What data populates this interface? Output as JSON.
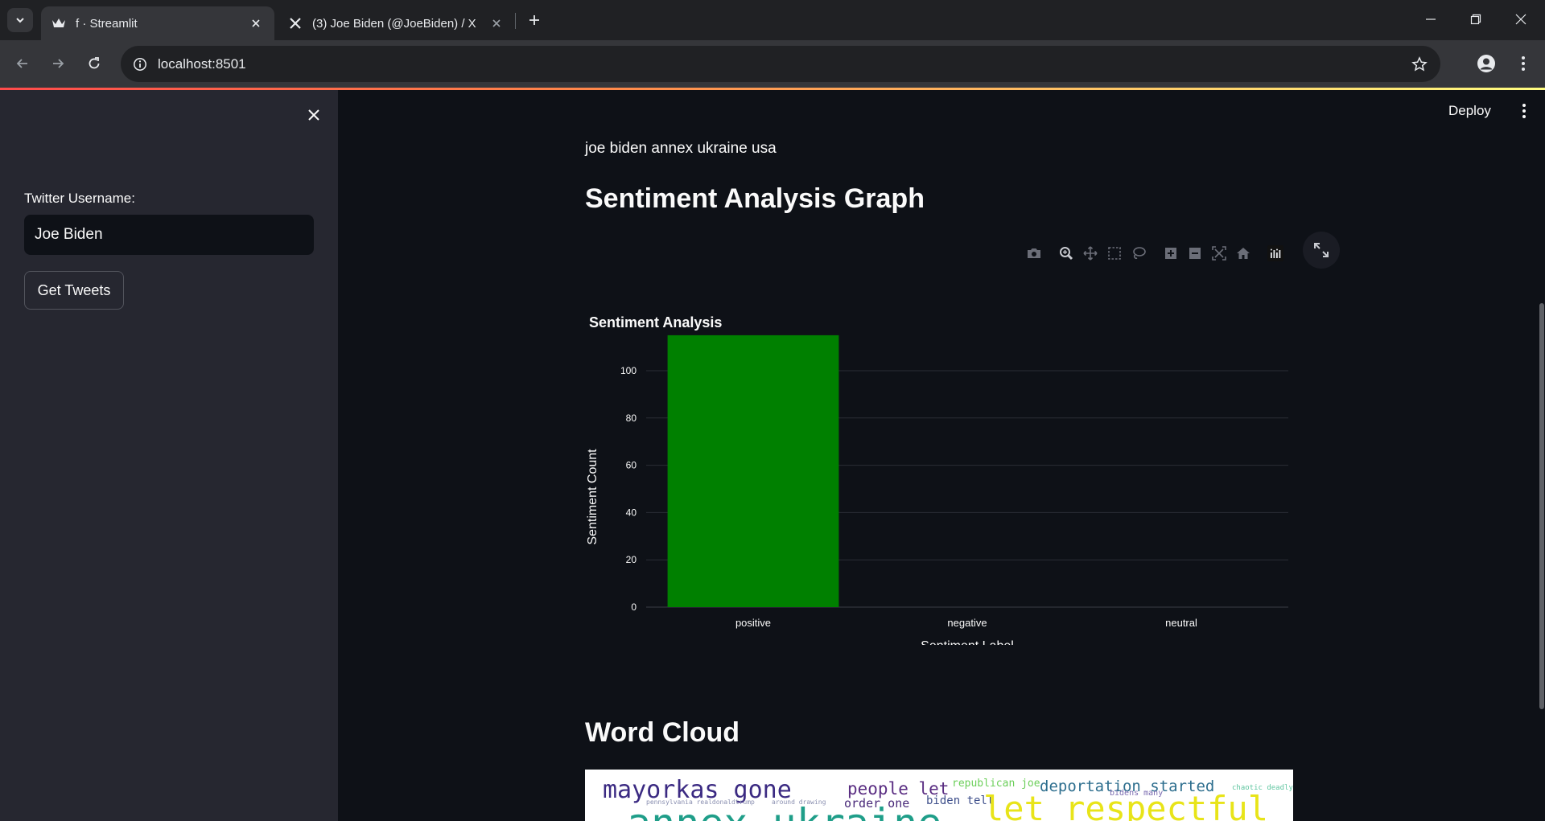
{
  "browser": {
    "tabs": [
      {
        "title": "f · Streamlit",
        "active": true,
        "icon": "streamlit-crown-icon"
      },
      {
        "title": "(3) Joe Biden (@JoeBiden) / X",
        "active": false,
        "icon": "x-logo-icon"
      }
    ],
    "url": "localhost:8501"
  },
  "app": {
    "header": {
      "deploy_label": "Deploy"
    },
    "sidebar": {
      "username_label": "Twitter Username:",
      "username_value": "Joe Biden",
      "button_label": "Get Tweets"
    },
    "main": {
      "tweet_text": "joe biden annex ukraine usa",
      "sentiment_heading": "Sentiment Analysis Graph",
      "wordcloud_heading": "Word Cloud"
    },
    "wordcloud_words": [
      {
        "text": "mayorkas gone",
        "color": "#3b2a82"
      },
      {
        "text": "people let",
        "color": "#5a2d82"
      },
      {
        "text": "republican joe",
        "color": "#6ccf5a"
      },
      {
        "text": "deportation started",
        "color": "#2d6e8e"
      },
      {
        "text": "bidens many",
        "color": "#7a6bb0"
      },
      {
        "text": "chaotic deadly",
        "color": "#5fc6a0"
      },
      {
        "text": "order one",
        "color": "#482878"
      },
      {
        "text": "biden tell",
        "color": "#3d4e8a"
      },
      {
        "text": "pennsylvania realdonaldtrump",
        "color": "#8a8fb0"
      },
      {
        "text": "around drawing",
        "color": "#8a8fb0"
      },
      {
        "text": "annex ukraine",
        "color": "#1f9e89"
      },
      {
        "text": "let respectful",
        "color": "#e8e419"
      }
    ]
  },
  "chart_data": {
    "type": "bar",
    "title": "Sentiment Analysis",
    "categories": [
      "positive",
      "negative",
      "neutral"
    ],
    "values": [
      115,
      0,
      0
    ],
    "xlabel": "Sentiment Label",
    "ylabel": "Sentiment Count",
    "ylim": [
      0,
      120
    ],
    "yticks": [
      0,
      20,
      40,
      60,
      80,
      100
    ],
    "bar_color": "#008000",
    "grid": true
  }
}
